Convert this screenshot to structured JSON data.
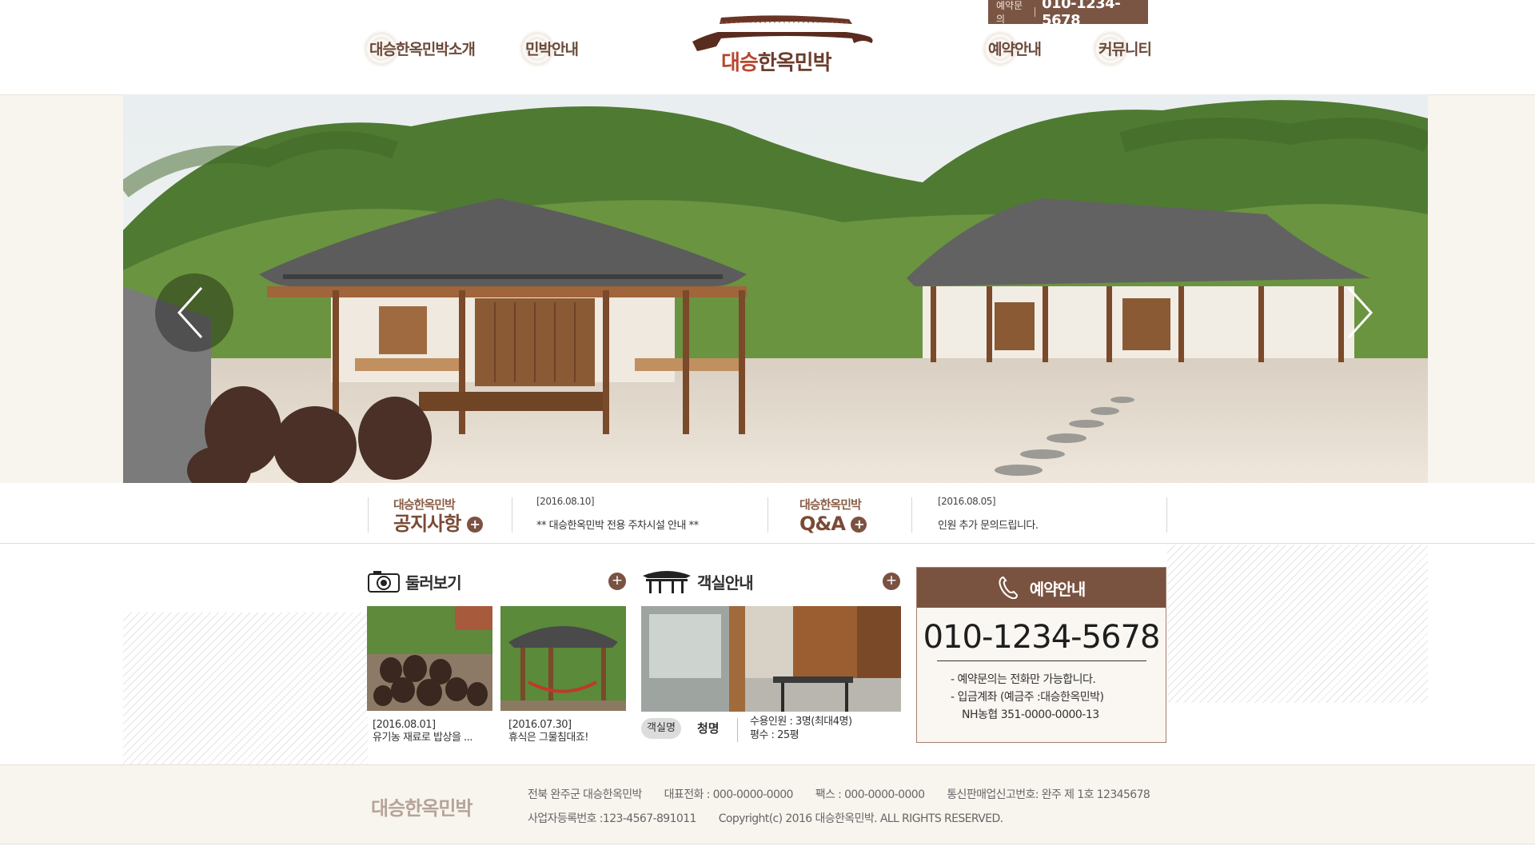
{
  "header": {
    "nav_left": [
      "대승한옥민박소개",
      "민박안내"
    ],
    "nav_right": [
      "예약안내",
      "커뮤니티"
    ],
    "reserve_tab_label": "예약문의",
    "reserve_tab_phone": "010-1234-5678",
    "logo_text_accent": "대승",
    "logo_text_rest": "한옥민박",
    "colors": {
      "brand": "#7a5544",
      "nav_text": "#6b4a3a"
    }
  },
  "hero": {
    "prev_icon": "chevron-left-icon",
    "next_icon": "chevron-right-icon"
  },
  "notice": {
    "block1_small": "대승한옥민박",
    "block1_big": "공지사항",
    "block1_date": "[2016.08.10]",
    "block1_text": "** 대승한옥민박 전용 주차시설 안내 **",
    "block2_small": "대승한옥민박",
    "block2_big": "Q&A",
    "block2_date": "[2016.08.05]",
    "block2_text": "인원 추가 문의드립니다.",
    "plus": "+"
  },
  "gallery": {
    "title": "둘러보기",
    "icon": "camera-icon",
    "plus": "+",
    "items": [
      {
        "date": "[2016.08.01]",
        "text": "유기농 재료로 밥상을 ..."
      },
      {
        "date": "[2016.07.30]",
        "text": "휴식은 그물침대죠!"
      }
    ]
  },
  "rooms": {
    "title": "객실안내",
    "icon": "pavilion-icon",
    "plus": "+",
    "label": "객실명",
    "name": "청명",
    "capacity": "수용인원 : 3명(최대4명)",
    "size": "평수 : 25평"
  },
  "reservation": {
    "title": "예약안내",
    "icon": "phone-icon",
    "phone": "010-1234-5678",
    "line1": "- 예약문의는 전화만 가능합니다.",
    "line2": "- 입금계좌 (예금주 :대승한옥민박)",
    "line3": "NH농협 351-0000-0000-13"
  },
  "footer": {
    "logo": "대승한옥민박",
    "address": "전북 완주군 대승한옥민박",
    "tel": "대표전화 : 000-0000-0000",
    "fax": "팩스 : 000-0000-0000",
    "mail_order": "통신판매업신고번호: 완주 제 1호 12345678",
    "biz_no": "사업자등록번호 :123-4567-891011",
    "copyright": "Copyright(c) 2016 대승한옥민박. ALL RIGHTS RESERVED."
  }
}
